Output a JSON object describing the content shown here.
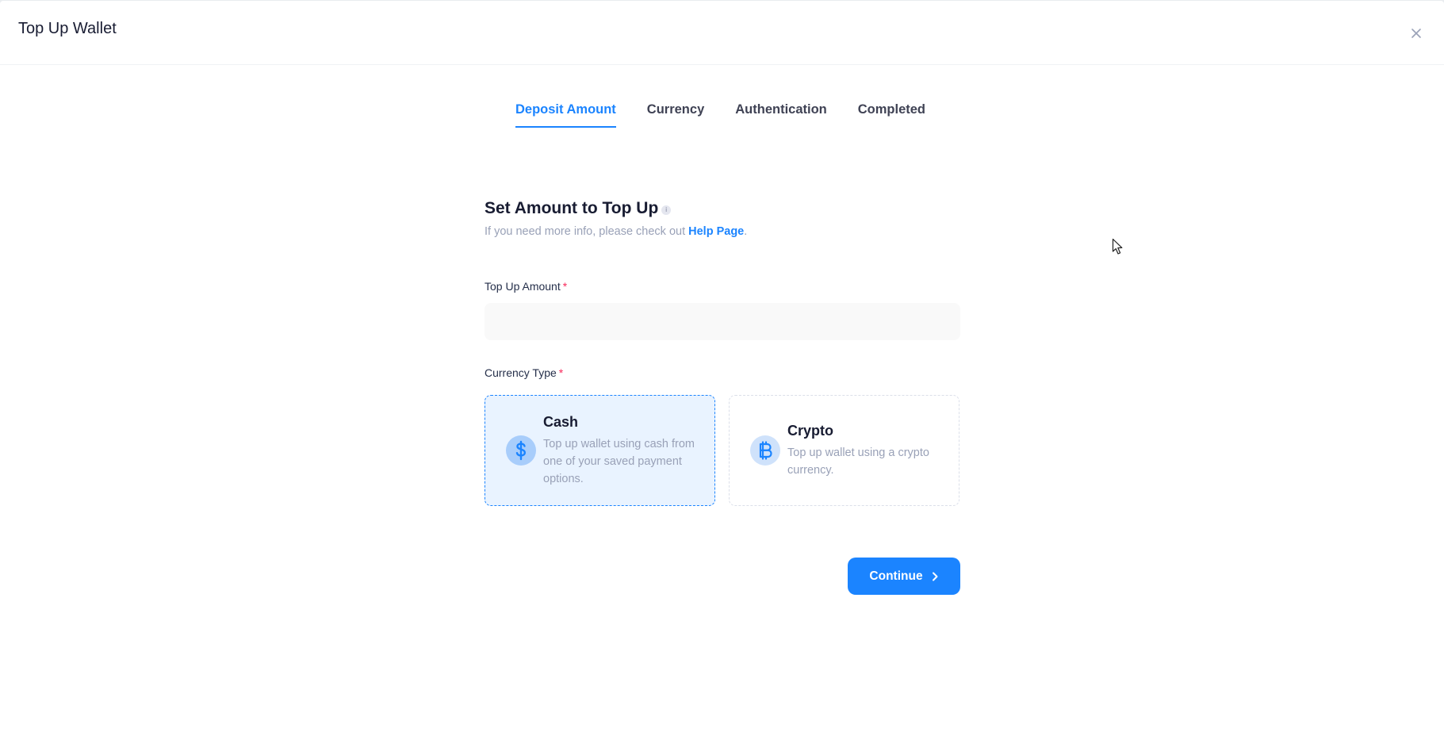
{
  "modal": {
    "title": "Top Up Wallet",
    "close_icon": "close-icon"
  },
  "stepper": {
    "steps": [
      {
        "label": "Deposit Amount",
        "active": true
      },
      {
        "label": "Currency",
        "active": false
      },
      {
        "label": "Authentication",
        "active": false
      },
      {
        "label": "Completed",
        "active": false
      }
    ]
  },
  "form": {
    "heading": "Set Amount to Top Up",
    "info_icon": "info-icon",
    "subtitle_prefix": "If you need more info, please check out",
    "help_link": "Help Page",
    "subtitle_suffix": ".",
    "amount_label": "Top Up Amount",
    "amount_value": "",
    "amount_placeholder": "",
    "required_mark": "*",
    "currency_label": "Currency Type",
    "options": [
      {
        "title": "Cash",
        "description": "Top up wallet using cash from one of your saved payment options.",
        "icon": "dollar-icon",
        "selected": true
      },
      {
        "title": "Crypto",
        "description": "Top up wallet using a crypto currency.",
        "icon": "bitcoin-icon",
        "selected": false
      }
    ],
    "continue_label": "Continue",
    "continue_icon": "arrow-right-icon"
  },
  "colors": {
    "accent": "#1b84ff",
    "required": "#f8285a",
    "muted_text": "#99a1b7",
    "selected_bg": "#e9f3ff"
  }
}
